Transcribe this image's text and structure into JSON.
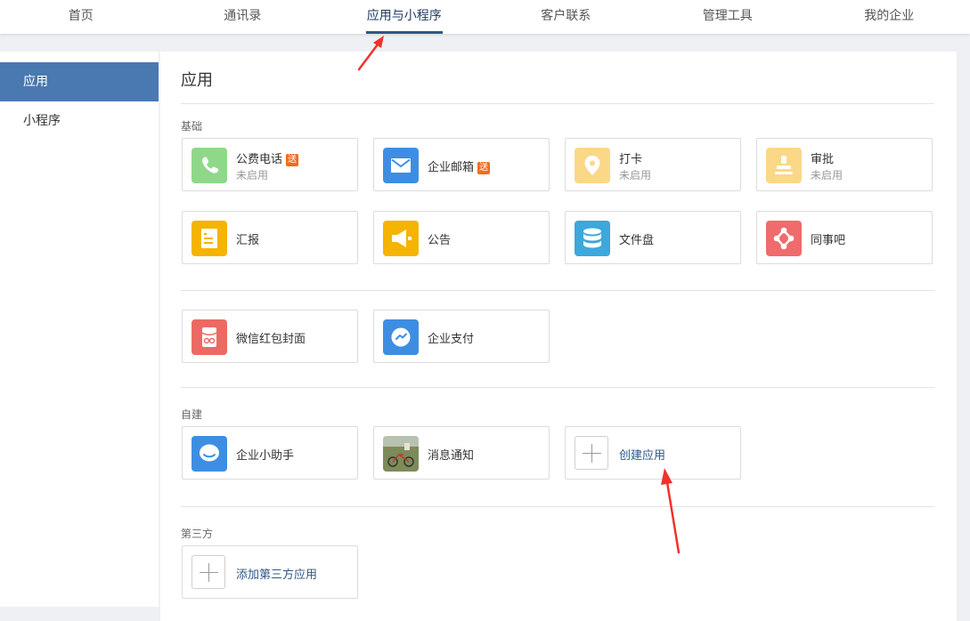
{
  "topnav": {
    "items": [
      "首页",
      "通讯录",
      "应用与小程序",
      "客户联系",
      "管理工具",
      "我的企业"
    ],
    "active": 2
  },
  "sidebar": {
    "items": [
      {
        "label": "应用",
        "active": true
      },
      {
        "label": "小程序",
        "active": false
      }
    ]
  },
  "main": {
    "title": "应用",
    "sections": {
      "basic": "基础",
      "custom": "自建",
      "third": "第三方"
    },
    "apps": {
      "phone": {
        "name": "公费电话",
        "badge": "送",
        "status": "未启用"
      },
      "mail": {
        "name": "企业邮箱",
        "badge": "送"
      },
      "checkin": {
        "name": "打卡",
        "status": "未启用"
      },
      "approval": {
        "name": "审批",
        "status": "未启用"
      },
      "report": {
        "name": "汇报"
      },
      "notice": {
        "name": "公告"
      },
      "disk": {
        "name": "文件盘"
      },
      "colleague": {
        "name": "同事吧"
      },
      "redpacket": {
        "name": "微信红包封面"
      },
      "pay": {
        "name": "企业支付"
      },
      "assistant": {
        "name": "企业小助手"
      },
      "msgnotify": {
        "name": "消息通知"
      }
    },
    "create_app": "创建应用",
    "add_third": "添加第三方应用"
  },
  "colors": {
    "accent": "#4a78b0",
    "badge": "#f26c1a",
    "arrow": "#f0332b"
  }
}
